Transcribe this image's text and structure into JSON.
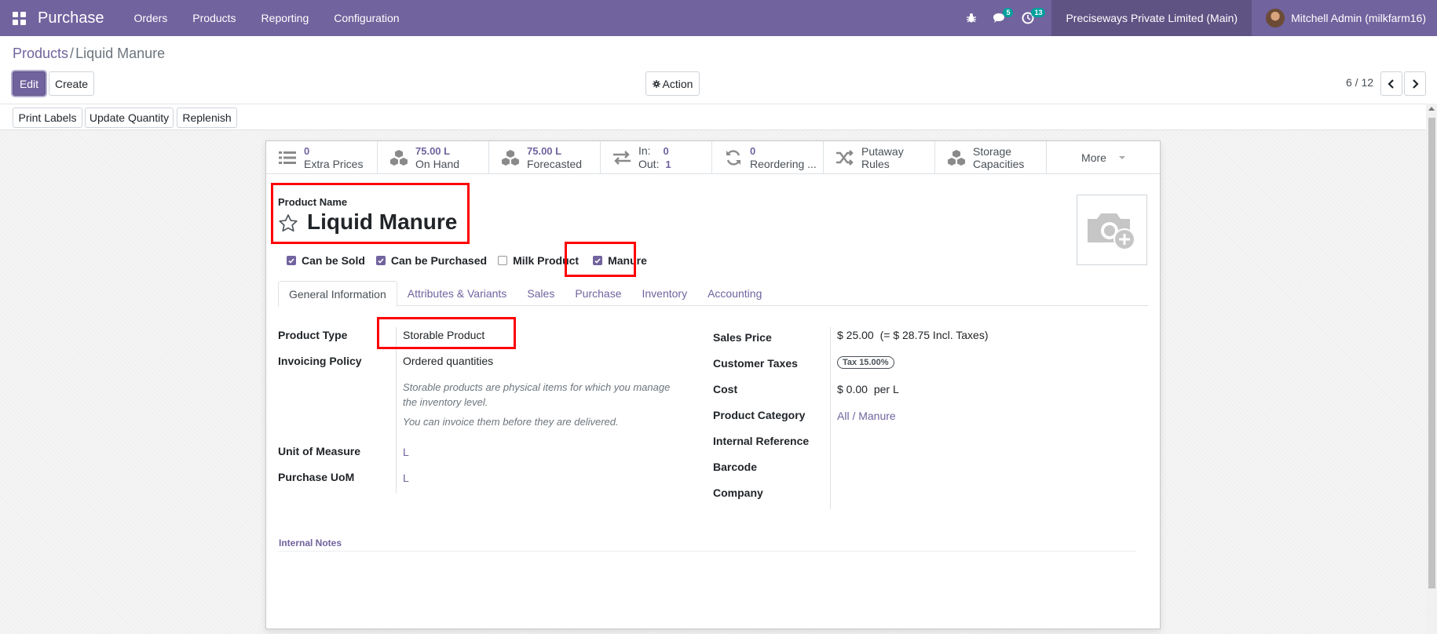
{
  "navbar": {
    "app_name": "Purchase",
    "menu": [
      "Orders",
      "Products",
      "Reporting",
      "Configuration"
    ],
    "messages_count": "5",
    "activities_count": "13",
    "company": "Preciseways Private Limited (Main)",
    "user": "Mitchell Admin (milkfarm16)",
    "accent": "#71639e"
  },
  "breadcrumb": {
    "parent": "Products",
    "separator": "/",
    "current": "Liquid Manure"
  },
  "control": {
    "edit_label": "Edit",
    "create_label": "Create",
    "action_label": "Action",
    "pager_value": "6 / 12",
    "action_buttons": [
      "Print Labels",
      "Update Quantity",
      "Replenish"
    ]
  },
  "smart_buttons": {
    "extra_prices": {
      "value": "0",
      "label": "Extra Prices"
    },
    "on_hand": {
      "value": "75.00 L",
      "label": "On Hand"
    },
    "forecasted": {
      "value": "75.00 L",
      "label": "Forecasted"
    },
    "moves": {
      "in_label": "In:",
      "in_value": "0",
      "out_label": "Out:",
      "out_value": "1"
    },
    "reordering": {
      "value": "0",
      "label": "Reordering ..."
    },
    "putaway": {
      "label": "Putaway Rules"
    },
    "storage": {
      "line1": "Storage",
      "line2": "Capacities"
    },
    "more": {
      "label": "More"
    }
  },
  "product": {
    "name_label": "Product Name",
    "name": "Liquid Manure",
    "checkboxes": [
      {
        "label": "Can be Sold",
        "checked": true
      },
      {
        "label": "Can be Purchased",
        "checked": true
      },
      {
        "label": "Milk Product",
        "checked": false
      },
      {
        "label": "Manure",
        "checked": true
      }
    ]
  },
  "tabs": [
    "General Information",
    "Attributes & Variants",
    "Sales",
    "Purchase",
    "Inventory",
    "Accounting"
  ],
  "general": {
    "product_type_label": "Product Type",
    "product_type": "Storable Product",
    "invoicing_policy_label": "Invoicing Policy",
    "invoicing_policy": "Ordered quantities",
    "help_line1": "Storable products are physical items for which you manage the inventory level.",
    "help_line2": "You can invoice them before they are delivered.",
    "uom_label": "Unit of Measure",
    "uom": "L",
    "purchase_uom_label": "Purchase UoM",
    "purchase_uom": "L",
    "sales_price_label": "Sales Price",
    "sales_price": "$ 25.00",
    "sales_price_incl": "(= $ 28.75 Incl. Taxes)",
    "customer_taxes_label": "Customer Taxes",
    "customer_tax": "Tax 15.00%",
    "cost_label": "Cost",
    "cost": "$ 0.00",
    "cost_unit": "per L",
    "category_label": "Product Category",
    "category": "All / Manure",
    "internal_ref_label": "Internal Reference",
    "barcode_label": "Barcode",
    "company_label": "Company"
  },
  "notes": {
    "label": "Internal Notes"
  }
}
